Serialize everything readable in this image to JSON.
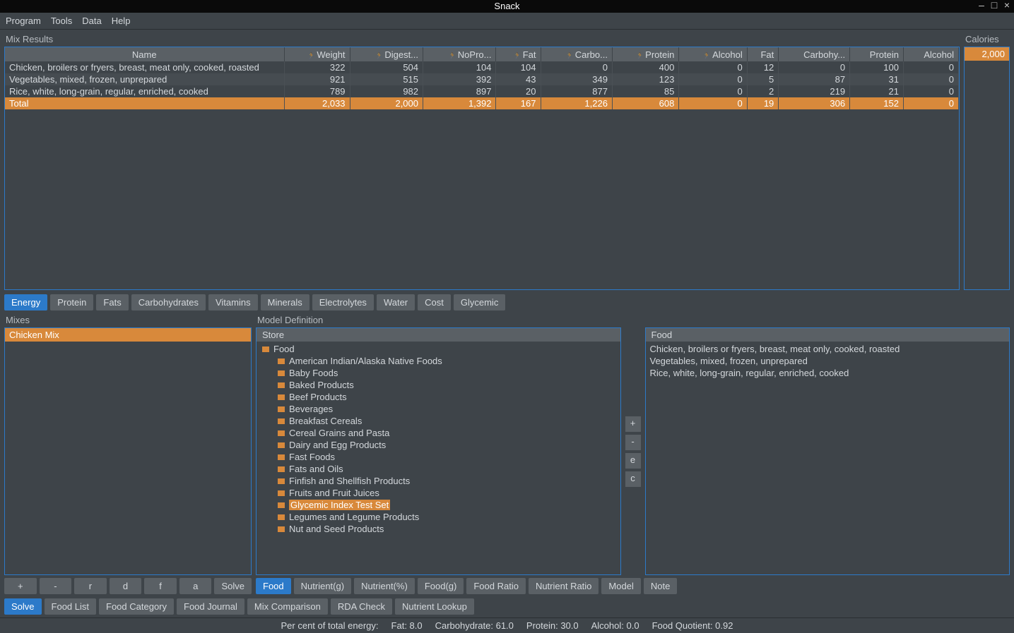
{
  "title": "Snack",
  "menu": [
    "Program",
    "Tools",
    "Data",
    "Help"
  ],
  "mix_results": {
    "label": "Mix Results",
    "columns": [
      "Name",
      "Weight",
      "Digest...",
      "NoPro...",
      "Fat",
      "Carbo...",
      "Protein",
      "Alcohol",
      "Fat",
      "Carbohy...",
      "Protein",
      "Alcohol"
    ],
    "rows": [
      {
        "name": "Chicken, broilers or fryers, breast, meat only, cooked, roasted",
        "v": [
          "322",
          "504",
          "104",
          "104",
          "0",
          "400",
          "0",
          "12",
          "0",
          "100",
          "0"
        ]
      },
      {
        "name": "Vegetables, mixed, frozen, unprepared",
        "v": [
          "921",
          "515",
          "392",
          "43",
          "349",
          "123",
          "0",
          "5",
          "87",
          "31",
          "0"
        ]
      },
      {
        "name": "Rice, white, long-grain, regular, enriched, cooked",
        "v": [
          "789",
          "982",
          "897",
          "20",
          "877",
          "85",
          "0",
          "2",
          "219",
          "21",
          "0"
        ]
      }
    ],
    "total": {
      "name": "Total",
      "v": [
        "2,033",
        "2,000",
        "1,392",
        "167",
        "1,226",
        "608",
        "0",
        "19",
        "306",
        "152",
        "0"
      ]
    }
  },
  "calories": {
    "label": "Calories",
    "value": "2,000"
  },
  "energy_tabs": [
    "Energy",
    "Protein",
    "Fats",
    "Carbohydrates",
    "Vitamins",
    "Minerals",
    "Electrolytes",
    "Water",
    "Cost",
    "Glycemic"
  ],
  "mixes": {
    "label": "Mixes",
    "items": [
      "Chicken Mix"
    ],
    "buttons": [
      "+",
      "-",
      "r",
      "d",
      "f",
      "a",
      "Solve"
    ]
  },
  "model_def": {
    "label": "Model Definition",
    "store": {
      "label": "Store",
      "root": "Food",
      "items": [
        "American Indian/Alaska Native Foods",
        "Baby Foods",
        "Baked Products",
        "Beef Products",
        "Beverages",
        "Breakfast Cereals",
        "Cereal Grains and Pasta",
        "Dairy and Egg Products",
        "Fast Foods",
        "Fats and Oils",
        "Finfish and Shellfish Products",
        "Fruits and Fruit Juices",
        "Glycemic Index Test Set",
        "Legumes and Legume Products",
        "Nut and Seed Products"
      ],
      "selected": "Glycemic Index Test Set"
    },
    "mid_buttons": [
      "+",
      "-",
      "e",
      "c"
    ],
    "food": {
      "label": "Food",
      "items": [
        "Chicken, broilers or fryers, breast, meat only, cooked, roasted",
        "Vegetables, mixed, frozen, unprepared",
        "Rice, white, long-grain, regular, enriched, cooked"
      ]
    },
    "bottom_tabs": [
      "Food",
      "Nutrient(g)",
      "Nutrient(%)",
      "Food(g)",
      "Food Ratio",
      "Nutrient Ratio",
      "Model",
      "Note"
    ]
  },
  "main_tabs": [
    "Solve",
    "Food List",
    "Food Category",
    "Food Journal",
    "Mix Comparison",
    "RDA Check",
    "Nutrient Lookup"
  ],
  "status": {
    "label": "Per cent of total energy:",
    "fat": "Fat: 8.0",
    "carb": "Carbohydrate: 61.0",
    "prot": "Protein: 30.0",
    "alc": "Alcohol: 0.0",
    "fq": "Food Quotient: 0.92"
  }
}
